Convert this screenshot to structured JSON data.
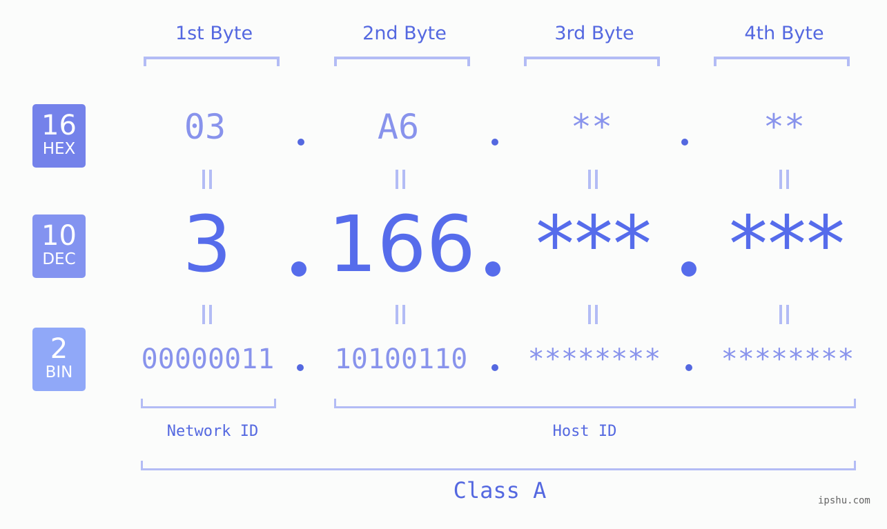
{
  "byte_headers": [
    "1st Byte",
    "2nd Byte",
    "3rd Byte",
    "4th Byte"
  ],
  "badges": {
    "hex": {
      "num": "16",
      "label": "HEX",
      "color": "#7482ea"
    },
    "dec": {
      "num": "10",
      "label": "DEC",
      "color": "#8393f0"
    },
    "bin": {
      "num": "2",
      "label": "BIN",
      "color": "#90a8f8"
    }
  },
  "hex_values": [
    "03",
    "A6",
    "**",
    "**"
  ],
  "dec_values": [
    "3",
    "166",
    "***",
    "***"
  ],
  "bin_values": [
    "00000011",
    "10100110",
    "********",
    "********"
  ],
  "separator": ".",
  "network_id_label": "Network ID",
  "host_id_label": "Host ID",
  "class_label": "Class A",
  "watermark": "ipshu.com",
  "colors": {
    "primary_text": "#5468e0",
    "light_text": "#8893ec",
    "bracket": "#b3bcf5",
    "background": "#fbfcfb"
  }
}
